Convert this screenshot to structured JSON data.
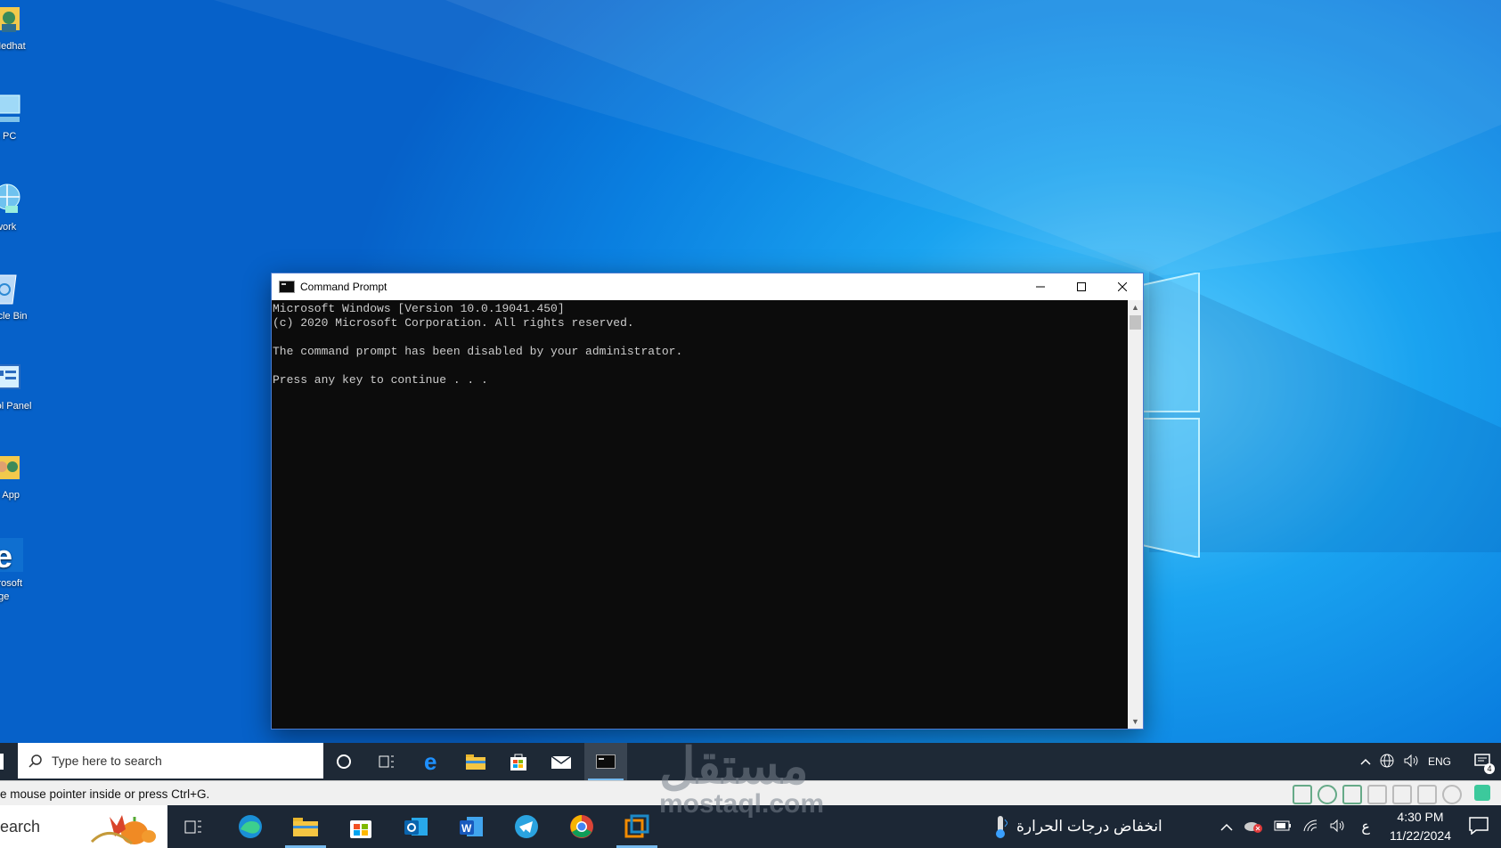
{
  "desktop": {
    "icons": [
      {
        "label": "Medhat",
        "icon": "user-folder-icon"
      },
      {
        "label": "is PC",
        "icon": "this-pc-icon"
      },
      {
        "label": "twork",
        "icon": "network-icon"
      },
      {
        "label": "ycle Bin",
        "icon": "recycle-bin-icon"
      },
      {
        "label": "rol Panel",
        "icon": "control-panel-icon"
      },
      {
        "label": "R App",
        "icon": "users-app-icon"
      },
      {
        "label": "crosoft\ndge",
        "icon": "edge-icon"
      }
    ]
  },
  "cmd_window": {
    "title": "Command Prompt",
    "lines": [
      "Microsoft Windows [Version 10.0.19041.450]",
      "(c) 2020 Microsoft Corporation. All rights reserved.",
      "",
      "The command prompt has been disabled by your administrator.",
      "",
      "Press any key to continue . . ."
    ]
  },
  "inner_taskbar": {
    "search_placeholder": "Type here to search",
    "icons": [
      "cortana-icon",
      "task-view-icon",
      "edge-icon",
      "file-explorer-icon",
      "store-icon",
      "mail-icon",
      "cmd-icon"
    ],
    "tray_lang": "ENG",
    "notification_count": "4"
  },
  "vm_status": {
    "message": "e mouse pointer inside or press Ctrl+G."
  },
  "outer_taskbar": {
    "search_text": "earch",
    "weather_text": "انخفاض درجات الحرارة",
    "ime_char": "ع",
    "time": "4:30 PM",
    "date": "11/22/2024"
  },
  "watermark": {
    "arabic": "مستقل",
    "latin": "mostaql.com"
  },
  "colors": {
    "desktop_blue": "#0a7fe0",
    "taskbar": "#1e2936",
    "console_bg": "#0c0c0c",
    "console_text": "#cccccc"
  }
}
